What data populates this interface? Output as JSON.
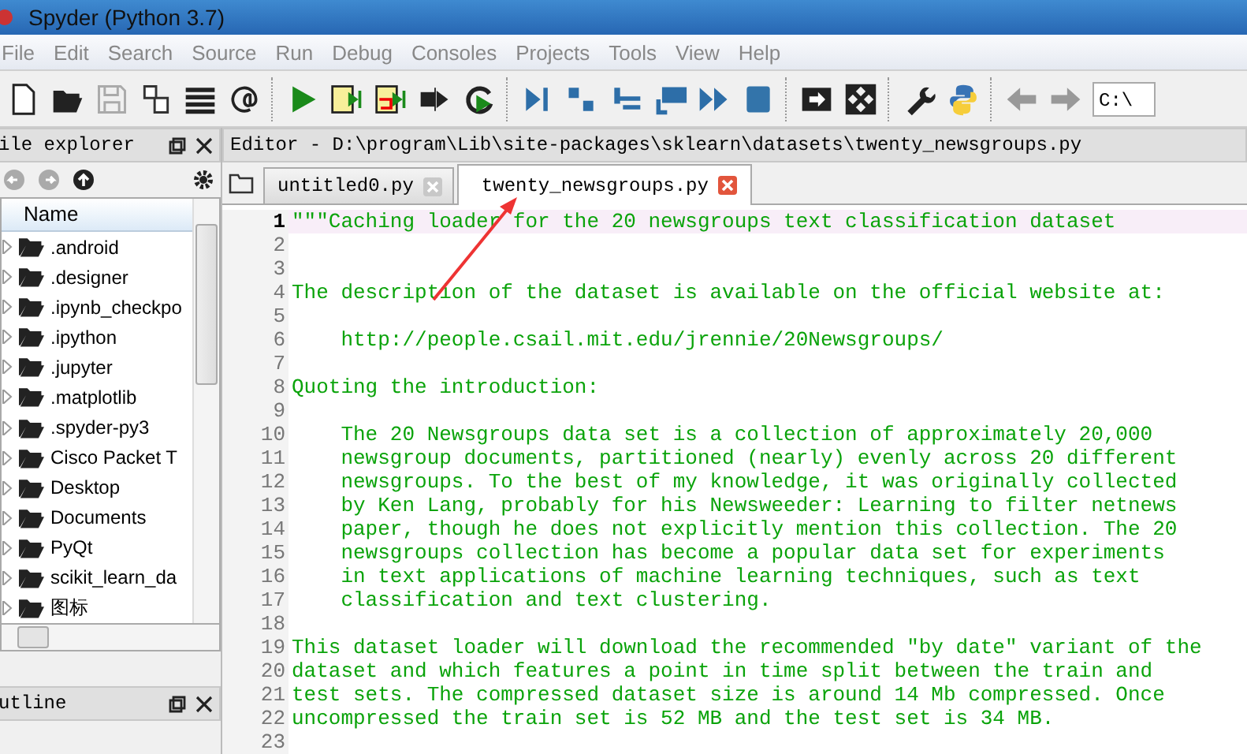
{
  "window": {
    "title": "Spyder (Python 3.7)"
  },
  "menu": [
    "File",
    "Edit",
    "Search",
    "Source",
    "Run",
    "Debug",
    "Consoles",
    "Projects",
    "Tools",
    "View",
    "Help"
  ],
  "path_field": {
    "value": "C:\\"
  },
  "file_explorer": {
    "title": "ile explorer",
    "column": "Name",
    "items": [
      {
        "name": ".android",
        "expanded": false
      },
      {
        "name": ".designer",
        "expanded": false
      },
      {
        "name": ".ipynb_checkpo",
        "expanded": false
      },
      {
        "name": ".ipython",
        "expanded": false
      },
      {
        "name": ".jupyter",
        "expanded": false
      },
      {
        "name": ".matplotlib",
        "expanded": false
      },
      {
        "name": ".spyder-py3",
        "expanded": false
      },
      {
        "name": "Cisco Packet T",
        "expanded": false
      },
      {
        "name": "Desktop",
        "expanded": false
      },
      {
        "name": "Documents",
        "expanded": false
      },
      {
        "name": "PyQt",
        "expanded": false
      },
      {
        "name": "scikit_learn_da",
        "expanded": false
      },
      {
        "name": "图标",
        "expanded": false
      }
    ]
  },
  "outline": {
    "title": "utline"
  },
  "editor": {
    "title": "Editor - D:\\program\\Lib\\site-packages\\sklearn\\datasets\\twenty_newsgroups.py",
    "tabs": [
      {
        "label": "untitled0.py",
        "selected": false
      },
      {
        "label": "twenty_newsgroups.py",
        "selected": true
      }
    ],
    "lines": [
      {
        "number": "1",
        "text": "\"\"\"Caching loader for the 20 newsgroups text classification dataset",
        "current": true
      },
      {
        "number": "2",
        "current": false
      },
      {
        "number": "3",
        "current": false
      },
      {
        "number": "4",
        "text": "The description of the dataset is available on the official website at:",
        "current": false
      },
      {
        "number": "5",
        "current": false
      },
      {
        "number": "6",
        "text": "    http://people.csail.mit.edu/jrennie/20Newsgroups/",
        "current": false
      },
      {
        "number": "7",
        "current": false
      },
      {
        "number": "8",
        "text": "Quoting the introduction:",
        "current": false
      },
      {
        "number": "9",
        "current": false
      },
      {
        "number": "10",
        "text": "    The 20 Newsgroups data set is a collection of approximately 20,000",
        "current": false
      },
      {
        "number": "11",
        "text": "    newsgroup documents, partitioned (nearly) evenly across 20 different",
        "current": false
      },
      {
        "number": "12",
        "text": "    newsgroups. To the best of my knowledge, it was originally collected",
        "current": false
      },
      {
        "number": "13",
        "text": "    by Ken Lang, probably for his Newsweeder: Learning to filter netnews",
        "current": false
      },
      {
        "number": "14",
        "text": "    paper, though he does not explicitly mention this collection. The 20",
        "current": false
      },
      {
        "number": "15",
        "text": "    newsgroups collection has become a popular data set for experiments",
        "current": false
      },
      {
        "number": "16",
        "text": "    in text applications of machine learning techniques, such as text",
        "current": false
      },
      {
        "number": "17",
        "text": "    classification and text clustering.",
        "current": false
      },
      {
        "number": "18",
        "current": false
      },
      {
        "number": "19",
        "text": "This dataset loader will download the recommended \"by date\" variant of the",
        "current": false
      },
      {
        "number": "20",
        "text": "dataset and which features a point in time split between the train and",
        "current": false
      },
      {
        "number": "21",
        "text": "test sets. The compressed dataset size is around 14 Mb compressed. Once",
        "current": false
      },
      {
        "number": "22",
        "text": "uncompressed the train set is 52 MB and the test set is 34 MB.",
        "current": false
      },
      {
        "number": "23",
        "current": false
      }
    ]
  }
}
